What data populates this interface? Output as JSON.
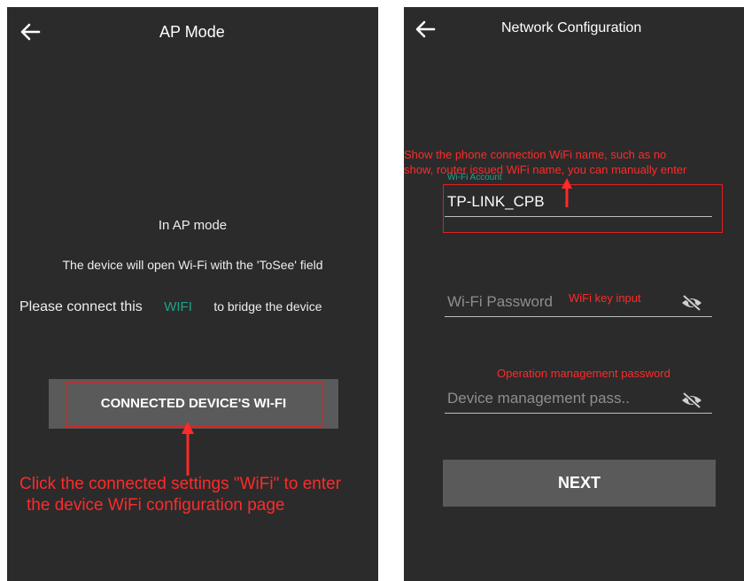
{
  "ap_screen": {
    "title": "AP Mode",
    "line1": "In AP mode",
    "line2": "The device will open Wi-Fi with the 'ToSee' field",
    "line3_prefix": "Please connect this",
    "line3_link": "WIFI",
    "line3_suffix": "to bridge the device",
    "button_label": "CONNECTED DEVICE'S WI-FI",
    "annotation_line1": "Click the connected settings \"WiFi\" to enter",
    "annotation_line2": "the device WiFi configuration page"
  },
  "network_screen": {
    "title": "Network Configuration",
    "annotation_top_line1": "Show the phone connection WiFi name, such as no",
    "annotation_top_line2": "show, router issued WiFi name, you can manually enter",
    "wifi_account_label": "Wi-Fi Account",
    "wifi_account_value": "TP-LINK_CPB",
    "wifi_password_placeholder": "Wi-Fi Password",
    "wifi_password_annotation": "WiFi key input",
    "device_password_annotation": "Operation management password",
    "device_password_placeholder": "Device management pass..",
    "next_label": "NEXT"
  },
  "colors": {
    "screen_bg": "#2b2b2b",
    "button_bg": "#5a5a5a",
    "accent_teal": "#1fa38a",
    "annotation_red": "#ff2a2a"
  },
  "icons": [
    "back-arrow-icon",
    "eye-slash-icon",
    "red-arrow-icon"
  ]
}
